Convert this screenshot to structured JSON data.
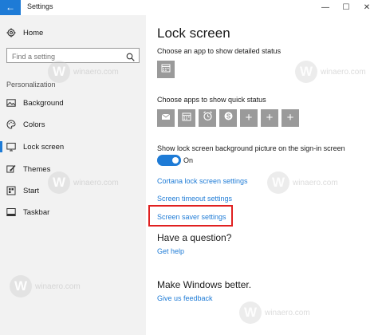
{
  "window": {
    "title": "Settings",
    "back_glyph": "←",
    "minimize_glyph": "—",
    "maximize_glyph": "☐",
    "close_glyph": "✕"
  },
  "sidebar": {
    "home_label": "Home",
    "search_placeholder": "Find a setting",
    "section_label": "Personalization",
    "items": [
      {
        "label": "Background",
        "icon": "image-icon"
      },
      {
        "label": "Colors",
        "icon": "palette-icon"
      },
      {
        "label": "Lock screen",
        "icon": "lock-screen-icon",
        "active": true
      },
      {
        "label": "Themes",
        "icon": "brush-icon"
      },
      {
        "label": "Start",
        "icon": "start-icon"
      },
      {
        "label": "Taskbar",
        "icon": "taskbar-icon"
      }
    ]
  },
  "main": {
    "title": "Lock screen",
    "detailed_status_label": "Choose an app to show detailed status",
    "quick_status_label": "Choose apps to show quick status",
    "quick_status_apps": [
      "mail-icon",
      "calendar-icon",
      "alarm-icon",
      "skype-icon",
      "plus-icon",
      "plus-icon",
      "plus-icon"
    ],
    "plus_glyph": "+",
    "background_toggle_label": "Show lock screen background picture on the sign-in screen",
    "background_toggle_state": "On",
    "links": {
      "cortana": "Cortana lock screen settings",
      "timeout": "Screen timeout settings",
      "screensaver": "Screen saver settings"
    },
    "question_heading": "Have a question?",
    "get_help": "Get help",
    "better_heading": "Make Windows better.",
    "feedback": "Give us feedback"
  },
  "watermark": {
    "logo_letter": "W",
    "site": "winaero.com"
  },
  "colors": {
    "accent": "#1e7bd6",
    "highlight_box": "#e02020",
    "tile_gray": "#9a9a9a"
  }
}
